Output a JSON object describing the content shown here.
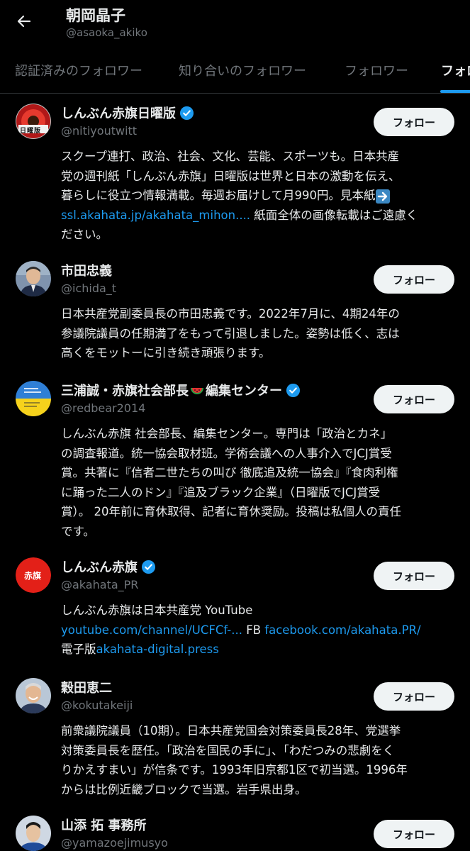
{
  "header": {
    "back_icon": "arrow-left-icon",
    "name": "朝岡晶子",
    "handle": "@asaoka_akiko"
  },
  "tabs": [
    {
      "label": "認証済みのフォロワー",
      "active": false
    },
    {
      "label": "知り合いのフォロワー",
      "active": false
    },
    {
      "label": "フォロワー",
      "active": false
    },
    {
      "label": "フォロー中",
      "active": true
    }
  ],
  "colors": {
    "accent": "#1d9bf0",
    "verified": "#1d9bf0",
    "background": "#000000"
  },
  "users": [
    {
      "name": "しんぶん赤旗日曜版",
      "verified": true,
      "handle": "@nitiyoutwitt",
      "follow_label": "フォロー",
      "avatar_text": "日曜版",
      "bio": [
        {
          "text": "スクープ連打、政治、社会、文化、芸能、スポーツも。日本共産"
        },
        {
          "text": "党の週刊紙「しんぶん赤旗」日曜版は世界と日本の激動を伝え、"
        },
        {
          "text": "暮らしに役立つ情報満載。毎週お届けして月990円。見本紙"
        },
        {
          "link": "ssl.akahata.jp/akahata_mihon....",
          "text": " 紙面全体の画像転載はご遠慮く"
        },
        {
          "text": "ださい。"
        }
      ]
    },
    {
      "name": "市田忠義",
      "verified": false,
      "handle": "@ichida_t",
      "follow_label": "フォロー",
      "bio": [
        {
          "text": "日本共産党副委員長の市田忠義です。2022年7月に、4期24年の"
        },
        {
          "text": "参議院議員の任期満了をもって引退しました。姿勢は低く、志は"
        },
        {
          "text": "高くをモットーに引き続き頑張ります。"
        }
      ]
    },
    {
      "name": "三浦誠・赤旗社会部長",
      "name_suffix": "編集センター",
      "verified": true,
      "handle": "@redbear2014",
      "follow_label": "フォロー",
      "bio": [
        {
          "text": "しんぶん赤旗 社会部長、編集センター。専門は「政治とカネ」"
        },
        {
          "text": "の調査報道。統一協会取材班。学術会議への人事介入でJCJ賞受"
        },
        {
          "text": "賞。共著に『信者二世たちの叫び 徹底追及統一協会』『食肉利権"
        },
        {
          "text": "に踊った二人のドン』『追及ブラック企業』（日曜版でJCJ賞受"
        },
        {
          "text": "賞）。 20年前に育休取得、記者に育休奨励。投稿は私個人の責任"
        },
        {
          "text": "です。"
        }
      ]
    },
    {
      "name": "しんぶん赤旗",
      "verified": true,
      "handle": "@akahata_PR",
      "follow_label": "フォロー",
      "avatar_text": "赤旗",
      "bio": [
        {
          "text": "しんぶん赤旗は日本共産党 YouTube"
        },
        {
          "link": "youtube.com/channel/UCFCf-...",
          "text": " FB ",
          "link2": "facebook.com/akahata.PR/"
        },
        {
          "text": "電子版",
          "link": "akahata-digital.press"
        }
      ]
    },
    {
      "name": "穀田恵二",
      "verified": false,
      "handle": "@kokutakeiji",
      "follow_label": "フォロー",
      "bio": [
        {
          "text": "前衆議院議員（10期）。日本共産党国会対策委員長28年、党選挙"
        },
        {
          "text": "対策委員長を歴任。「政治を国民の手に」、「わだつみの悲劇をく"
        },
        {
          "text": "りかえすまい」が信条です。1993年旧京都1区で初当選。1996年"
        },
        {
          "text": "からは比例近畿ブロックで当選。岩手県出身。"
        }
      ]
    },
    {
      "name": "山添 拓 事務所",
      "verified": false,
      "handle": "@yamazoejimusyo",
      "follow_label": "フォロー",
      "bio": []
    }
  ]
}
